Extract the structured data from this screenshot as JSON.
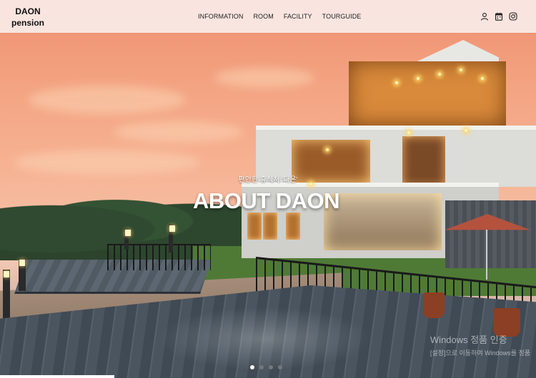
{
  "header": {
    "logo_line1": "DAON",
    "logo_line2": "pension",
    "nav": [
      "INFORMATION",
      "ROOM",
      "FACILITY",
      "TOURGUIDE"
    ],
    "icons": [
      "user-icon",
      "calendar-icon",
      "instagram-icon"
    ]
  },
  "hero": {
    "tagline": "편안한 휴식처 '다온'",
    "headline": "ABOUT DAON",
    "slides_total": 4,
    "active_slide": 1
  },
  "watermark": {
    "line1": "Windows 정품 인증",
    "line2": "[설정]으로 이동하여 Windows를 정품"
  },
  "colors": {
    "header_bg": "#faece8",
    "sky_top": "#ee8f6f",
    "accent_text": "#ffffff"
  }
}
